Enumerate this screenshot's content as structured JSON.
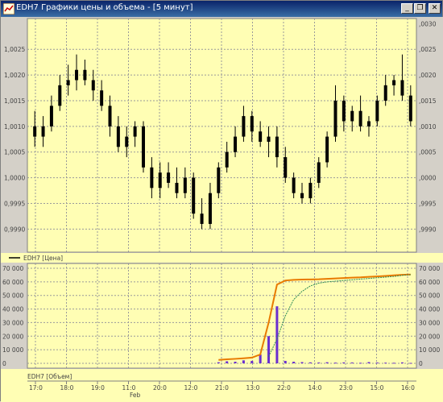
{
  "window": {
    "title": "EDH7 Графики цены и объема - [5 минут]",
    "buttons": [
      {
        "name": "minimize-button",
        "glyph": "_"
      },
      {
        "name": "restore-button",
        "glyph": "❐"
      },
      {
        "name": "close-button",
        "glyph": "✕"
      }
    ],
    "colors": {
      "panel_bg": "#fffeb4",
      "grid": "#9a9a9a",
      "candle": "#000000",
      "titlebar": "#0a246a"
    }
  },
  "price_panel": {
    "y_ticks_left": [
      "1,0025",
      "1,0020",
      "1,0015",
      "1,0010",
      "1,0005",
      "1,0000",
      "0,9995",
      "0,9990"
    ],
    "y_ticks_right": [
      ",0030",
      ",0025",
      ",0020",
      ",0015",
      ",0010",
      ",0005",
      ",0000",
      ",9995",
      ",9990"
    ],
    "legend_label": "EDH7 [Цена]"
  },
  "volume_panel": {
    "y_ticks_left": [
      "70 000",
      "60 000",
      "50 000",
      "40 000",
      "30 000",
      "20 000",
      "10 000",
      "0"
    ],
    "y_ticks_right": [
      "70 000",
      "60 000",
      "50 000",
      "40 000",
      "30 000",
      "20 000",
      "10 000",
      "0"
    ]
  },
  "bottom_legend": "EDH7 [Объем]",
  "time_axis": {
    "labels": [
      "17:0",
      "18:0",
      "19:0",
      "11:0",
      "20:0",
      "12:0",
      "21:0",
      "13:0",
      "22:0",
      "14:0",
      "23:0",
      "15:0",
      "16:0"
    ],
    "month_label": "Feb"
  },
  "chart_data": [
    {
      "type": "bar",
      "title": "",
      "ylim": [
        0.99855,
        1.0031
      ],
      "candles": [
        [
          1.001,
          1.0013,
          1.0006,
          1.0008
        ],
        [
          1.0008,
          1.0012,
          1.0006,
          1.001
        ],
        [
          1.001,
          1.0016,
          1.0009,
          1.0014
        ],
        [
          1.0014,
          1.002,
          1.0013,
          1.0018
        ],
        [
          1.0018,
          1.0022,
          1.0016,
          1.0019
        ],
        [
          1.0019,
          1.0024,
          1.0017,
          1.0021
        ],
        [
          1.0021,
          1.0023,
          1.0018,
          1.0019
        ],
        [
          1.0019,
          1.0021,
          1.0015,
          1.0017
        ],
        [
          1.0017,
          1.0019,
          1.0013,
          1.0014
        ],
        [
          1.0014,
          1.0016,
          1.0008,
          1.001
        ],
        [
          1.001,
          1.0012,
          1.0005,
          1.0006
        ],
        [
          1.0006,
          1.001,
          1.0004,
          1.0008
        ],
        [
          1.0008,
          1.0011,
          1.0006,
          1.001
        ],
        [
          1.001,
          1.0011,
          1.0001,
          1.0002
        ],
        [
          1.0002,
          1.0004,
          0.9996,
          0.9998
        ],
        [
          0.9998,
          1.0003,
          0.9996,
          1.0001
        ],
        [
          1.0001,
          1.0003,
          0.9998,
          0.9999
        ],
        [
          0.9999,
          1.0002,
          0.9996,
          0.9997
        ],
        [
          0.9997,
          1.0002,
          0.9996,
          1.0
        ],
        [
          1.0,
          1.0001,
          0.9992,
          0.9993
        ],
        [
          0.9993,
          0.9996,
          0.999,
          0.9991
        ],
        [
          0.9991,
          0.9999,
          0.999,
          0.9997
        ],
        [
          0.9997,
          1.0003,
          0.9996,
          1.0002
        ],
        [
          1.0002,
          1.0007,
          1.0001,
          1.0005
        ],
        [
          1.0005,
          1.001,
          1.0004,
          1.0008
        ],
        [
          1.0008,
          1.0014,
          1.0007,
          1.0012
        ],
        [
          1.0012,
          1.0013,
          1.0007,
          1.0009
        ],
        [
          1.0009,
          1.0011,
          1.0006,
          1.0007
        ],
        [
          1.0007,
          1.001,
          1.0004,
          1.0008
        ],
        [
          1.0008,
          1.001,
          1.0002,
          1.0004
        ],
        [
          1.0004,
          1.0006,
          0.9999,
          1.0
        ],
        [
          1.0,
          1.0001,
          0.9996,
          0.9997
        ],
        [
          0.9997,
          0.9999,
          0.9995,
          0.9996
        ],
        [
          0.9996,
          1.0,
          0.9995,
          0.9999
        ],
        [
          0.9999,
          1.0004,
          0.9998,
          1.0003
        ],
        [
          1.0003,
          1.0009,
          1.0002,
          1.0008
        ],
        [
          1.0008,
          1.0018,
          1.0007,
          1.0015
        ],
        [
          1.0015,
          1.0016,
          1.0009,
          1.0011
        ],
        [
          1.0011,
          1.0014,
          1.0009,
          1.0013
        ],
        [
          1.0013,
          1.0016,
          1.0009,
          1.001
        ],
        [
          1.001,
          1.0012,
          1.0008,
          1.0011
        ],
        [
          1.0011,
          1.0016,
          1.001,
          1.0015
        ],
        [
          1.0015,
          1.002,
          1.0014,
          1.0018
        ],
        [
          1.0018,
          1.002,
          1.0016,
          1.0019
        ],
        [
          1.0019,
          1.0024,
          1.0015,
          1.0016
        ],
        [
          1.0016,
          1.0018,
          1.001,
          1.0011
        ]
      ]
    },
    {
      "type": "bar",
      "title": "",
      "ylim": [
        0,
        70000
      ],
      "volume": [
        0,
        0,
        0,
        0,
        0,
        0,
        0,
        0,
        0,
        0,
        0,
        0,
        0,
        0,
        0,
        0,
        0,
        0,
        0,
        0,
        0,
        0,
        800,
        1500,
        1200,
        2200,
        1800,
        6500,
        20000,
        42000,
        1800,
        1200,
        900,
        700,
        600,
        800,
        500,
        700,
        600,
        400,
        900,
        600,
        500,
        400,
        700,
        300
      ],
      "cum_volume_orange": [
        0,
        0,
        0,
        0,
        0,
        0,
        0,
        0,
        0,
        0,
        0,
        0,
        0,
        0,
        0,
        0,
        0,
        0,
        0,
        0,
        0,
        0,
        2500,
        3000,
        3300,
        3700,
        4200,
        6500,
        30000,
        58000,
        61000,
        61500,
        61700,
        61800,
        61900,
        62200,
        62500,
        62800,
        63100,
        63300,
        63700,
        64000,
        64400,
        64800,
        65200,
        65400
      ],
      "avg_volume_green": [
        0,
        0,
        0,
        0,
        0,
        0,
        0,
        0,
        0,
        0,
        0,
        0,
        0,
        0,
        0,
        0,
        0,
        0,
        0,
        0,
        0,
        0,
        0,
        0,
        0,
        0,
        0,
        0,
        5000,
        18000,
        35000,
        47000,
        53000,
        57000,
        59000,
        60000,
        60500,
        61000,
        61500,
        62000,
        62500,
        63000,
        63500,
        64000,
        64800,
        65300
      ]
    }
  ]
}
